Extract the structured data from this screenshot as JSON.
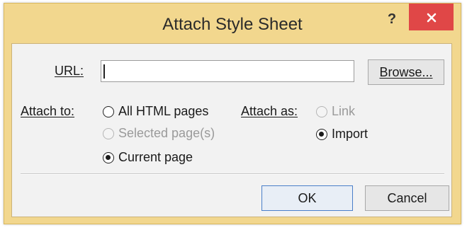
{
  "dialog": {
    "title": "Attach Style Sheet",
    "help_label": "?",
    "url_label": "URL:",
    "url_value": "",
    "browse_label": "Browse...",
    "attach_to_label": "Attach to:",
    "attach_to_options": [
      {
        "label": "All HTML pages",
        "checked": false,
        "enabled": true
      },
      {
        "label": "Selected page(s)",
        "checked": false,
        "enabled": false
      },
      {
        "label": "Current page",
        "checked": true,
        "enabled": true
      }
    ],
    "attach_as_label": "Attach as:",
    "attach_as_options": [
      {
        "label": "Link",
        "checked": false,
        "enabled": false
      },
      {
        "label": "Import",
        "checked": true,
        "enabled": true
      }
    ],
    "ok_label": "OK",
    "cancel_label": "Cancel"
  },
  "colors": {
    "frame": "#f2d78e",
    "close_button": "#e04747",
    "client_background": "#f2f2f2"
  }
}
